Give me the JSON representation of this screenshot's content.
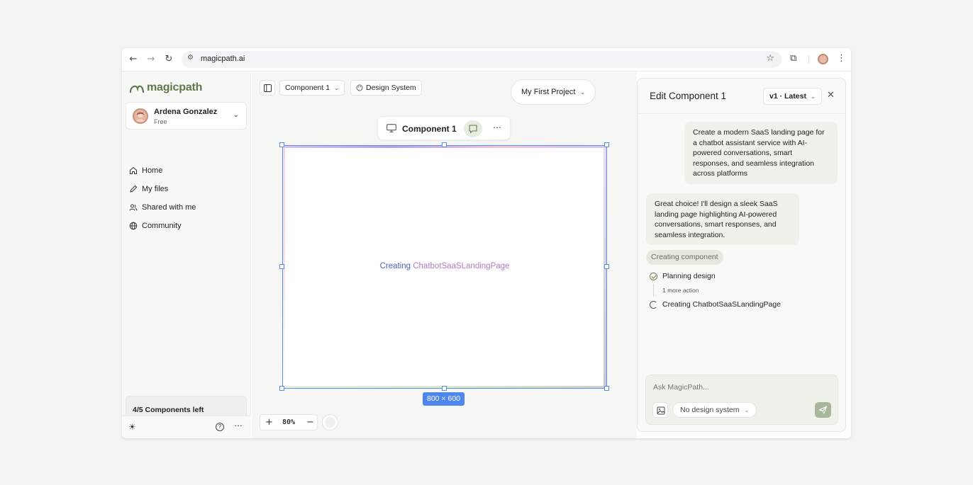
{
  "browser": {
    "url": "magicpath.ai"
  },
  "sidebar": {
    "logo": "magicpath",
    "user": {
      "name": "Ardena Gonzalez",
      "plan": "Free"
    },
    "items": [
      {
        "label": "Home",
        "icon": "home-icon"
      },
      {
        "label": "My files",
        "icon": "pencil-icon"
      },
      {
        "label": "Shared with me",
        "icon": "users-icon"
      },
      {
        "label": "Community",
        "icon": "globe-icon"
      }
    ],
    "quota": {
      "label": "4/5 Components left",
      "used": 4,
      "total": 5
    }
  },
  "toolbar": {
    "component_select": "Component 1",
    "design_system": "Design System",
    "project": "My First Project"
  },
  "canvas": {
    "component_name": "Component 1",
    "status_prefix": "Creating ",
    "status_name": "ChatbotSaaSLandingPage",
    "size_label": "800 × 600",
    "zoom": "80%"
  },
  "panel": {
    "title": "Edit Component 1",
    "version": "v1 · Latest",
    "user_message": "Create a modern SaaS landing page for a chatbot assistant service with AI-powered conversations, smart responses, and seamless integration across platforms",
    "ai_message": "Great choice! I'll design a sleek SaaS landing page highlighting AI-powered conversations, smart responses, and seamless integration.",
    "status_chip": "Creating component",
    "step_done": "Planning design",
    "more_action": "1 more action",
    "step_current": "Creating ChatbotSaaSLandingPage",
    "input_placeholder": "Ask MagicPath...",
    "design_system_select": "No design system"
  },
  "colors": {
    "accent": "#6a7e56",
    "selection": "#5b8ee8"
  }
}
